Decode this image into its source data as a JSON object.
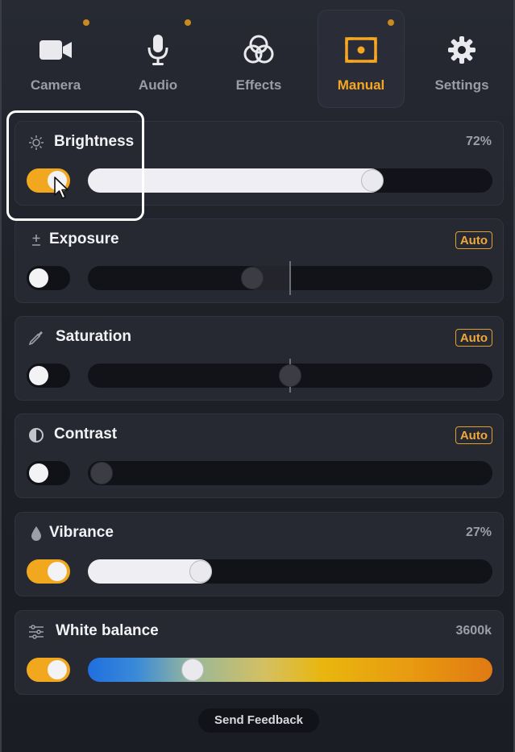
{
  "colors": {
    "accent": "#f5a623",
    "background": "#1d1f26",
    "card": "#262932",
    "track": "#121319"
  },
  "tabs": [
    {
      "label": "Camera",
      "icon": "camera-icon",
      "active": false,
      "has_dot": true
    },
    {
      "label": "Audio",
      "icon": "microphone-icon",
      "active": false,
      "has_dot": true
    },
    {
      "label": "Effects",
      "icon": "effects-circles-icon",
      "active": false,
      "has_dot": false
    },
    {
      "label": "Manual",
      "icon": "manual-focus-icon",
      "active": true,
      "has_dot": true
    },
    {
      "label": "Settings",
      "icon": "gear-icon",
      "active": false,
      "has_dot": false
    }
  ],
  "controls": {
    "brightness": {
      "title": "Brightness",
      "icon": "sun-icon",
      "value": "72%",
      "enabled": true,
      "level": 0.72
    },
    "exposure": {
      "title": "Exposure",
      "icon": "plus-minus-icon",
      "badge": "Auto",
      "enabled": false,
      "level": 0.4
    },
    "saturation": {
      "title": "Saturation",
      "icon": "eyedropper-icon",
      "badge": "Auto",
      "enabled": false,
      "level": 0.5
    },
    "contrast": {
      "title": "Contrast",
      "icon": "contrast-icon",
      "badge": "Auto",
      "enabled": false,
      "level": 0.0
    },
    "vibrance": {
      "title": "Vibrance",
      "icon": "drop-icon",
      "value": "27%",
      "enabled": true,
      "level": 0.27
    },
    "white_balance": {
      "title": "White balance",
      "icon": "sliders-icon",
      "value": "3600k",
      "enabled": true,
      "level": 0.26
    }
  },
  "footer": {
    "feedback_label": "Send Feedback"
  }
}
